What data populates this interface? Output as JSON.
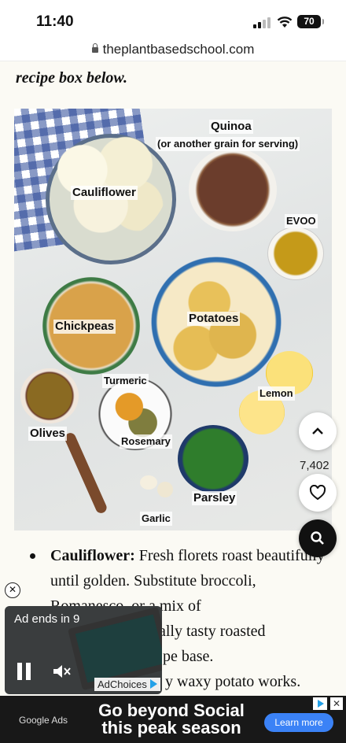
{
  "status_bar": {
    "time": "11:40",
    "battery": "70"
  },
  "browser": {
    "url": "theplantbasedschool.com"
  },
  "article": {
    "intro_text": "recipe box below.",
    "photo_labels": {
      "quinoa": "Quinoa",
      "quinoa_note": "(or another grain for serving)",
      "cauliflower": "Cauliflower",
      "evoo": "EVOO",
      "chickpeas": "Chickpeas",
      "potatoes": "Potatoes",
      "turmeric": "Turmeric",
      "lemon": "Lemon",
      "olives": "Olives",
      "rosemary": "Rosemary",
      "parsley": "Parsley",
      "garlic": "Garlic"
    },
    "bullets": [
      {
        "term": "Cauliflower:",
        "text": "Fresh florets roast beautifully until golden. Substitute broccoli, Romanesco, or a mix of",
        "visible_fragments": [
          "ually tasty roasted",
          "pe base.",
          "y waxy potato works."
        ]
      }
    ]
  },
  "floating": {
    "like_count": "7,402"
  },
  "video_ad": {
    "countdown": "Ad ends in 9",
    "adchoices": "AdChoices"
  },
  "banner_ad": {
    "source": "Google Ads",
    "headline_line1": "Go beyond Social",
    "headline_line2": "this peak season",
    "cta": "Learn more"
  }
}
